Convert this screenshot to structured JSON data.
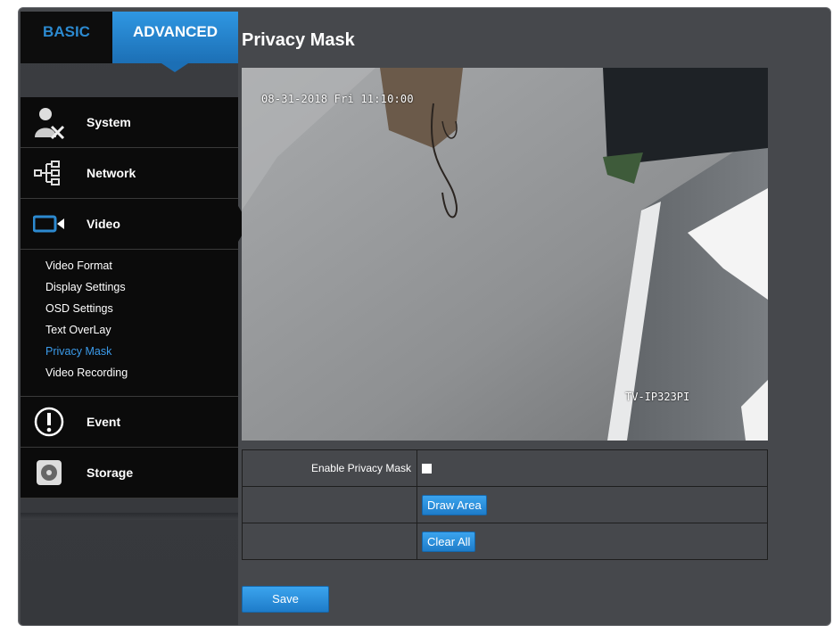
{
  "tabs": {
    "basic": "BASIC",
    "advanced": "ADVANCED"
  },
  "menu": {
    "system": "System",
    "network": "Network",
    "video": "Video",
    "event": "Event",
    "storage": "Storage"
  },
  "video_submenu": [
    "Video Format",
    "Display Settings",
    "OSD Settings",
    "Text OverLay",
    "Privacy Mask",
    "Video Recording"
  ],
  "page": {
    "title": "Privacy Mask"
  },
  "camera": {
    "timestamp": "08-31-2018 Fri 11:10:00",
    "name": "TV-IP323PI"
  },
  "form": {
    "enable_label": "Enable Privacy Mask",
    "draw_area": "Draw Area",
    "clear_all": "Clear All",
    "save": "Save"
  },
  "colors": {
    "accent": "#2c8ad0",
    "active_sub": "#3b9bea",
    "panel": "#46484c"
  }
}
